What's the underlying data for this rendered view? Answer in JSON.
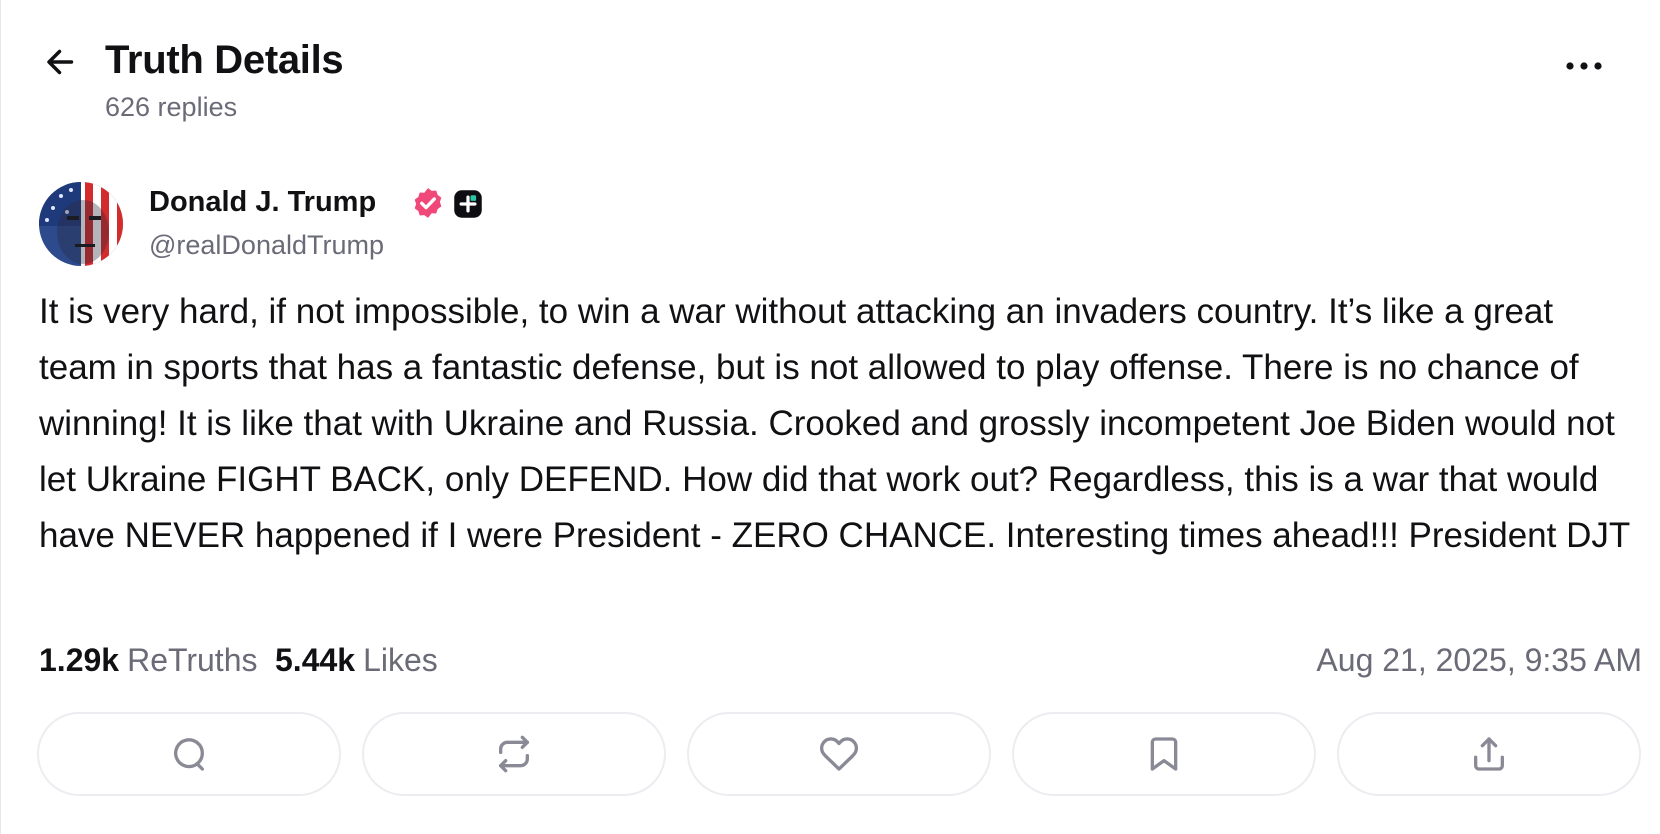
{
  "header": {
    "title": "Truth Details",
    "replies": "626 replies"
  },
  "post": {
    "author_name": "Donald J. Trump",
    "handle": "@realDonaldTrump",
    "text": "It is very hard, if not impossible, to win a war without attacking an invaders country. It’s like a great team in sports that has a fantastic defense, but is not allowed to play offense. There is no chance of winning! It is like that with Ukraine and Russia. Crooked and grossly incompetent Joe Biden would not let Ukraine FIGHT BACK, only DEFEND. How did that work out? Regardless, this is a war that would have NEVER happened if I were President - ZERO CHANCE. Interesting times ahead!!! President DJT",
    "retruths_count": "1.29k",
    "retruths_label": "ReTruths",
    "likes_count": "5.44k",
    "likes_label": "Likes",
    "timestamp": "Aug 21, 2025, 9:35 AM"
  },
  "icons": {
    "back": "arrow-left-icon",
    "more": "more-horizontal-icon",
    "verified": "verified-badge-icon",
    "plus": "plus-badge-icon",
    "reply": "reply-icon",
    "retruth": "retruth-icon",
    "like": "heart-icon",
    "bookmark": "bookmark-icon",
    "share": "share-icon"
  },
  "colors": {
    "verified": "#f1487a",
    "secondary_text": "#6b6b78",
    "border": "#ececf1",
    "icon": "#8a8a96"
  }
}
